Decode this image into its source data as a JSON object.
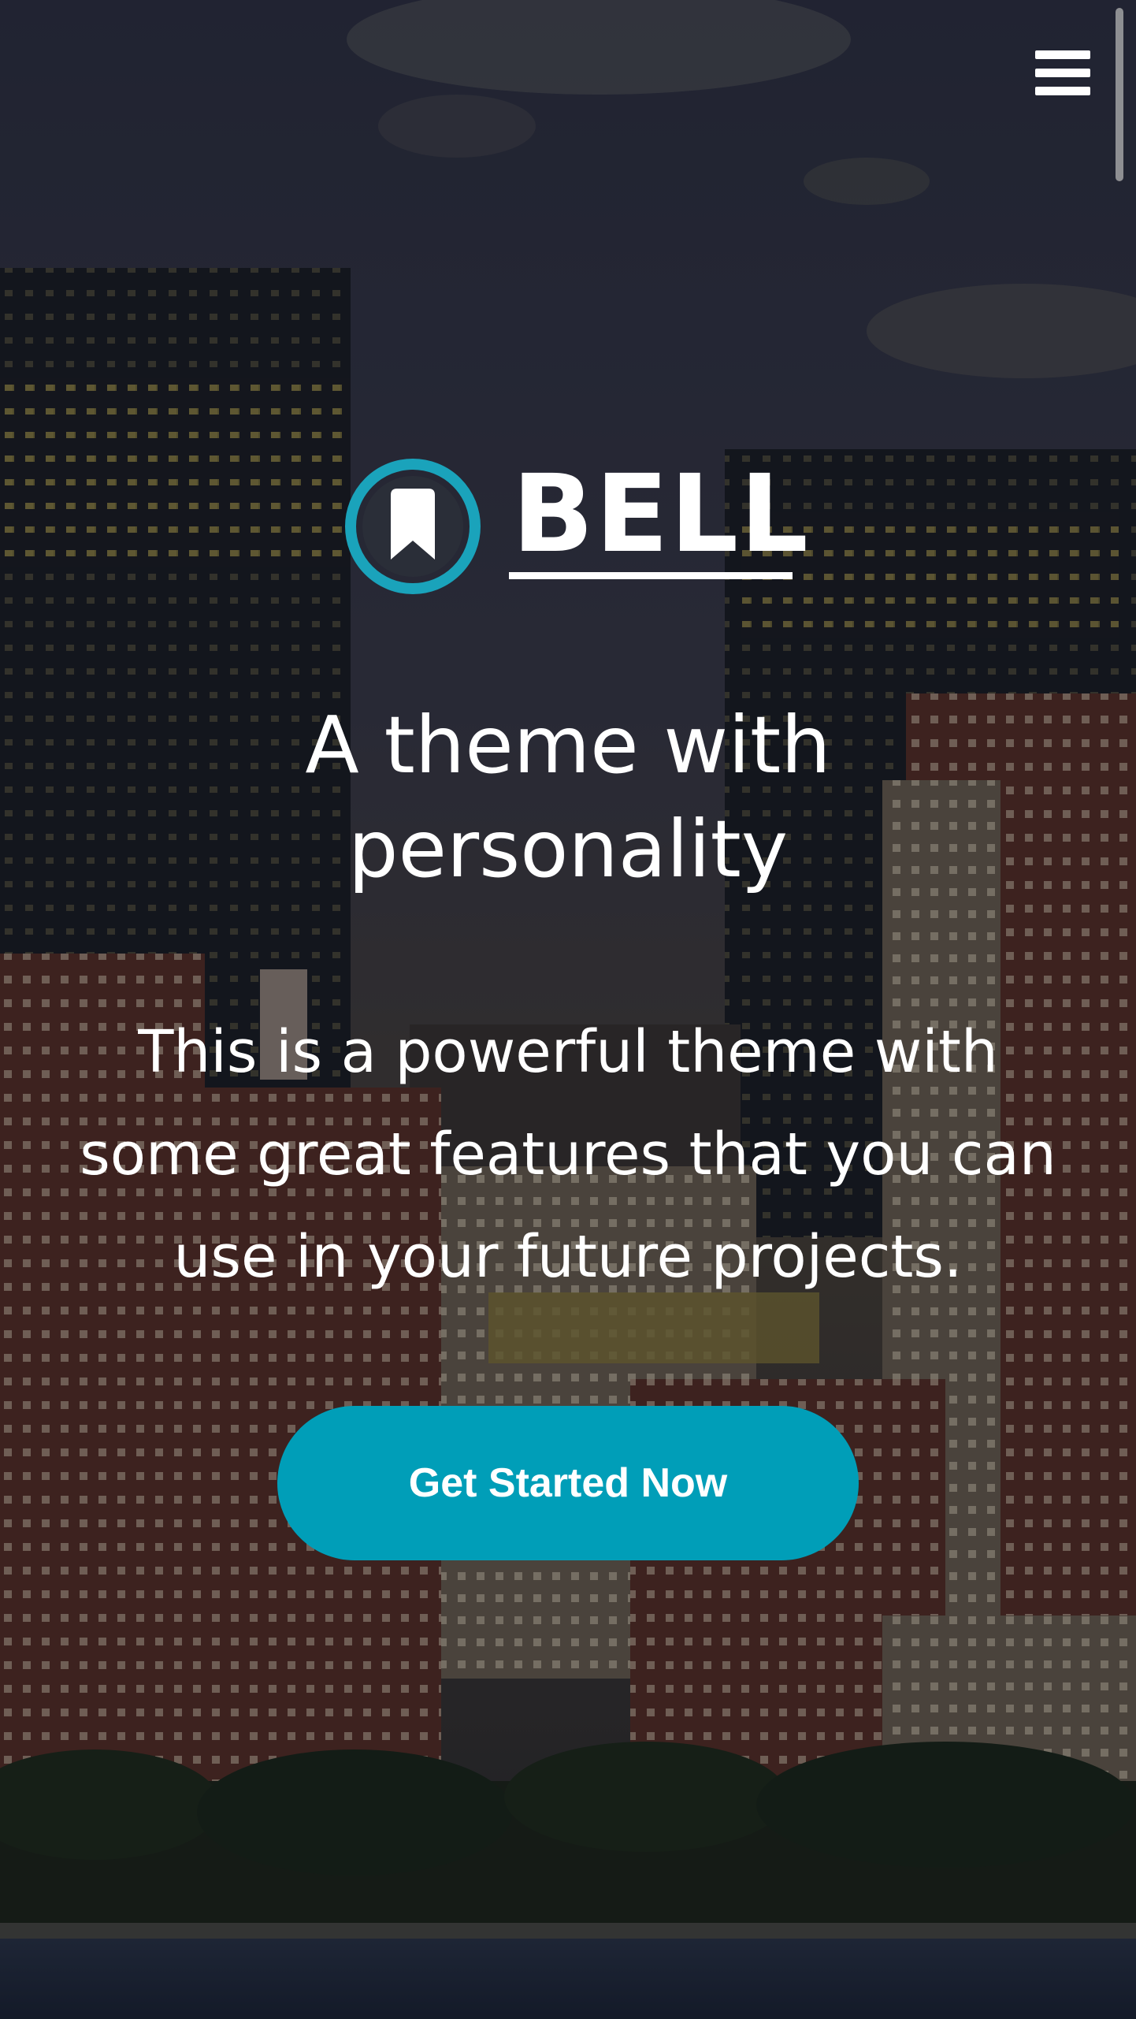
{
  "nav": {
    "menu_icon": "hamburger-menu-icon"
  },
  "logo": {
    "mark_icon": "bookmark-circle-logo-icon",
    "wordmark": "BELL",
    "accent_color": "#1aa3bb"
  },
  "hero": {
    "headline": "A theme with personality",
    "description": "This is a powerful theme with some great features that you can use in your future projects.",
    "cta_label": "Get Started Now",
    "cta_color": "#009eb8",
    "background": "night city skyline photo"
  }
}
